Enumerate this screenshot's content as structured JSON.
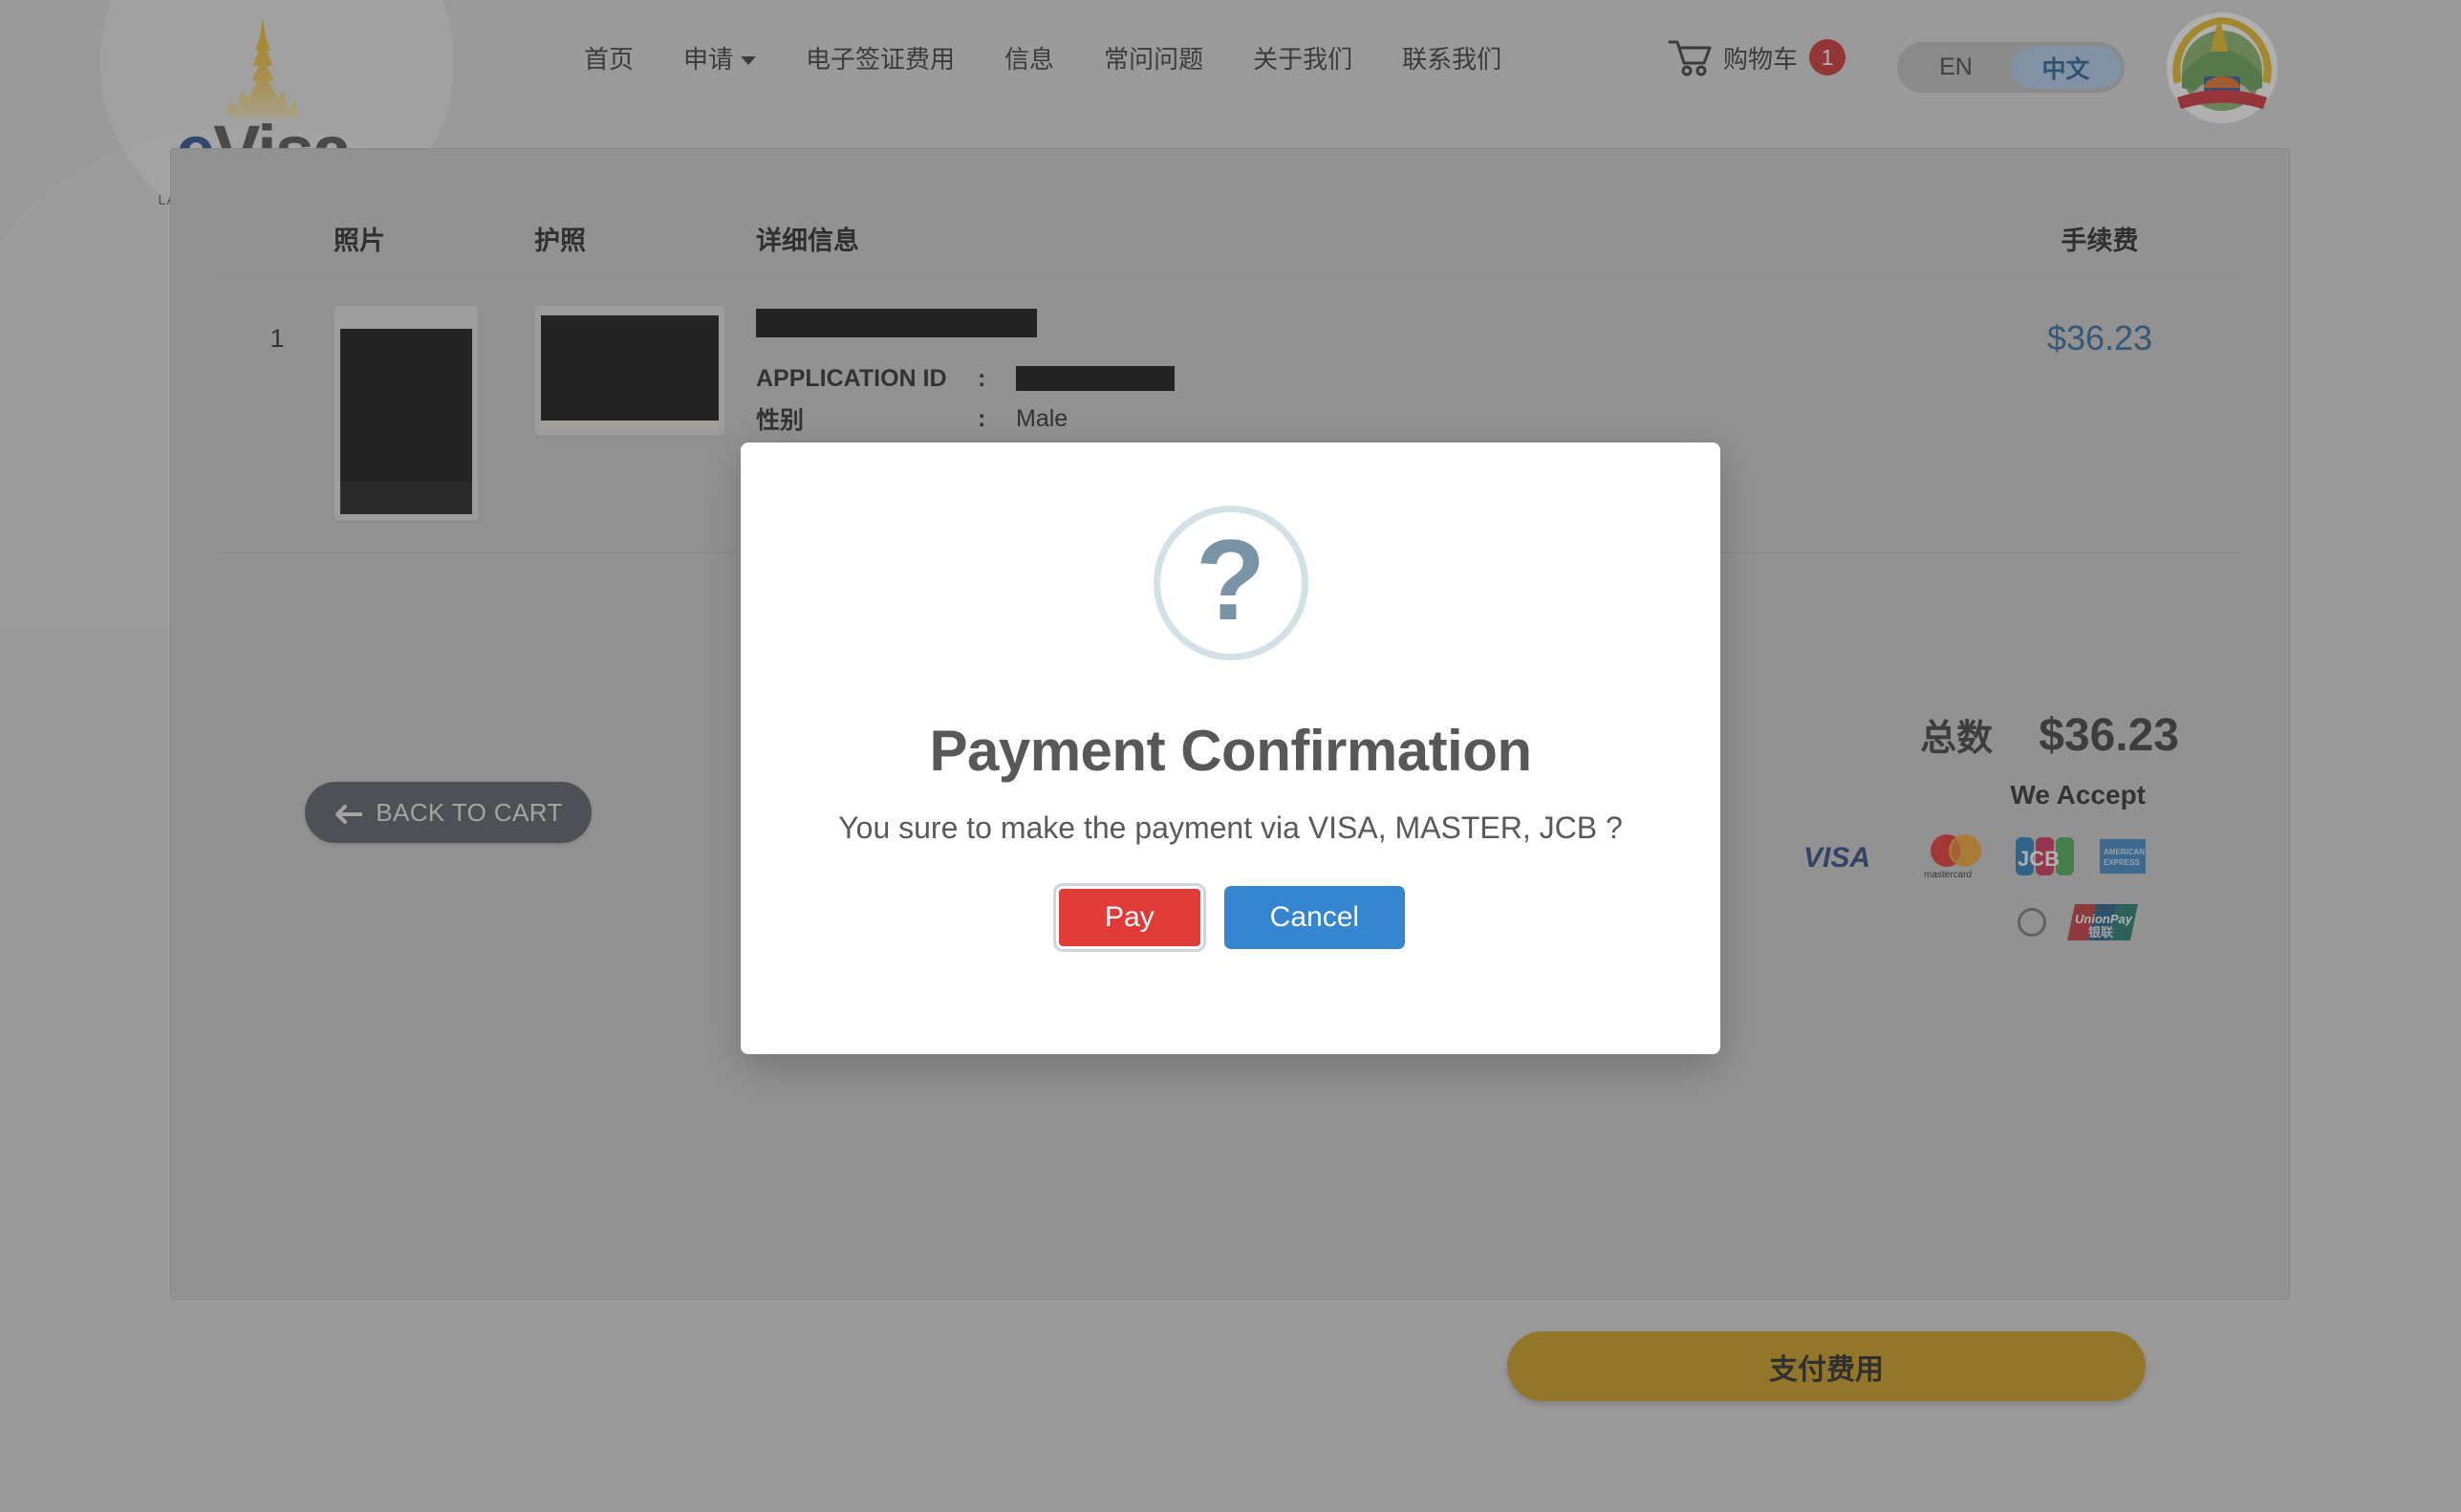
{
  "header": {
    "logo": {
      "wordmark_prefix": "e",
      "wordmark": "Visa",
      "tagline": "LAO OFFICIAL ONLINE VISA",
      "stupa_icon": "stupa-icon",
      "emblem_icon": "lao-national-emblem-icon"
    },
    "nav_items": [
      {
        "label": "首页",
        "has_caret": false
      },
      {
        "label": "申请",
        "has_caret": true
      },
      {
        "label": "电子签证费用",
        "has_caret": false
      },
      {
        "label": "信息",
        "has_caret": false
      },
      {
        "label": "常问问题",
        "has_caret": false
      },
      {
        "label": "关于我们",
        "has_caret": false
      },
      {
        "label": "联系我们",
        "has_caret": false
      }
    ],
    "cart": {
      "icon": "shopping-cart-icon",
      "label": "购物车",
      "badge_count": "1"
    },
    "language": {
      "options": [
        "EN",
        "中文"
      ],
      "selected": "中文",
      "en_label": "EN",
      "zh_label": "中文"
    }
  },
  "cart_table": {
    "columns": {
      "no": "",
      "photo": "照片",
      "passport": "护照",
      "details": "详细信息",
      "fee": "手续费"
    },
    "row": {
      "no": "1",
      "photo_thumbnail": "applicant-photo-redacted",
      "passport_thumbnail": "passport-scan-redacted",
      "name_redacted": "",
      "details": [
        {
          "label": "APPLICATION ID",
          "colon": ":",
          "value": "",
          "redacted": true
        },
        {
          "label": "性别",
          "colon": ":",
          "value": "Male",
          "redacted": false
        }
      ],
      "fee": "$36.23"
    }
  },
  "totals": {
    "label": "总数",
    "value": "$36.23"
  },
  "actions": {
    "back_to_cart": "BACK TO CART",
    "back_arrow_icon": "arrow-left-icon",
    "pay_fee": "支付费用"
  },
  "payment_methods": {
    "title": "We Accept",
    "card_brands": [
      "VISA",
      "mastercard",
      "JCB",
      "AMERICAN EXPRESS"
    ],
    "unionpay": "UnionPay 银联"
  },
  "dialog": {
    "icon": "question-mark-icon",
    "icon_glyph": "?",
    "title": "Payment Confirmation",
    "message": "You sure to make the payment via VISA, MASTER, JCB ?",
    "pay_label": "Pay",
    "cancel_label": "Cancel"
  },
  "colors": {
    "accent_gold": "#c9970d",
    "pay_red": "#e13b37",
    "cancel_blue": "#3585d0",
    "fee_blue": "#1f6096",
    "badge_red": "#cc2222"
  }
}
